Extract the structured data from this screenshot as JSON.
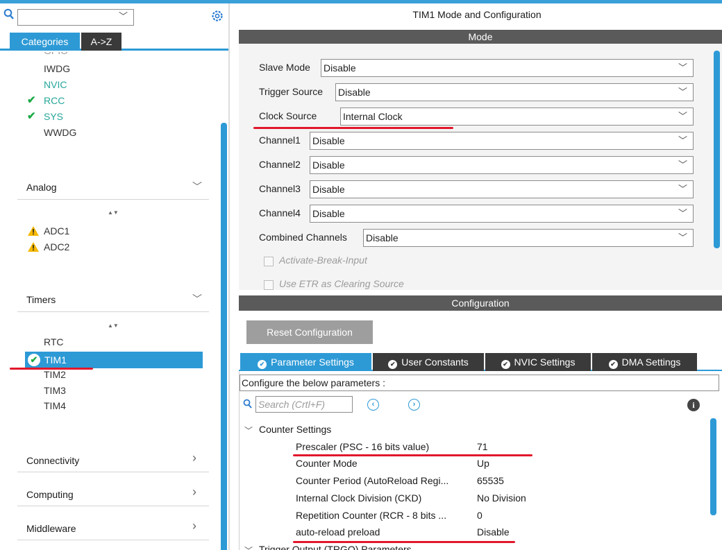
{
  "left": {
    "search": {
      "value": "",
      "chevron": "﹀"
    },
    "tabs": {
      "categories": "Categories",
      "az": "A->Z"
    },
    "system_core_items": [
      {
        "label": "GPIO",
        "status": "none"
      },
      {
        "label": "IWDG",
        "status": "none"
      },
      {
        "label": "NVIC",
        "status": "none"
      },
      {
        "label": "RCC",
        "status": "ok"
      },
      {
        "label": "SYS",
        "status": "ok"
      },
      {
        "label": "WWDG",
        "status": "none"
      }
    ],
    "categories": {
      "analog": "Analog",
      "timers": "Timers",
      "connectivity": "Connectivity",
      "computing": "Computing",
      "middleware": "Middleware"
    },
    "analog_items": [
      {
        "label": "ADC1",
        "status": "warning"
      },
      {
        "label": "ADC2",
        "status": "warning"
      }
    ],
    "timers_items": [
      {
        "label": "RTC",
        "status": "none"
      },
      {
        "label": "TIM1",
        "status": "selected-ok"
      },
      {
        "label": "TIM2",
        "status": "none"
      },
      {
        "label": "TIM3",
        "status": "none"
      },
      {
        "label": "TIM4",
        "status": "none"
      }
    ],
    "chevron_down": "﹀",
    "chevron_right": "›",
    "sort_glyph": "▲▼"
  },
  "right": {
    "title": "TIM1 Mode and Configuration",
    "mode_header": "Mode",
    "mode_fields": [
      {
        "label": "Slave Mode",
        "value": "Disable"
      },
      {
        "label": "Trigger Source",
        "value": "Disable"
      },
      {
        "label": "Clock Source",
        "value": "Internal Clock"
      },
      {
        "label": "Channel1",
        "value": "Disable"
      },
      {
        "label": "Channel2",
        "value": "Disable"
      },
      {
        "label": "Channel3",
        "value": "Disable"
      },
      {
        "label": "Channel4",
        "value": "Disable"
      },
      {
        "label": "Combined Channels",
        "value": "Disable"
      }
    ],
    "mode_checkboxes": [
      {
        "label": "Activate-Break-Input",
        "checked": false
      },
      {
        "label": "Use ETR as Clearing Source",
        "checked": false
      }
    ],
    "config_header": "Configuration",
    "reset_button": "Reset Configuration",
    "param_tabs": [
      {
        "label": "Parameter Settings",
        "active": true
      },
      {
        "label": "User Constants",
        "active": false
      },
      {
        "label": "NVIC Settings",
        "active": false
      },
      {
        "label": "DMA Settings",
        "active": false
      }
    ],
    "config_hint": "Configure the below parameters :",
    "param_search_placeholder": "Search (Crtl+F)",
    "nav_prev": "‹",
    "nav_next": "›",
    "info_glyph": "i",
    "group_counter": "Counter Settings",
    "group_trigger": "Trigger Output (TRGO) Parameters",
    "parameters": [
      {
        "name": "Prescaler (PSC - 16 bits value)",
        "value": "71"
      },
      {
        "name": "Counter Mode",
        "value": "Up"
      },
      {
        "name": "Counter Period (AutoReload Regi...",
        "value": "65535"
      },
      {
        "name": "Internal Clock Division (CKD)",
        "value": "No Division"
      },
      {
        "name": "Repetition Counter (RCR - 8 bits ...",
        "value": "0"
      },
      {
        "name": "auto-reload preload",
        "value": "Disable"
      }
    ]
  },
  "colors": {
    "accent": "#2d9ad6",
    "header_dark": "#5a5a5a",
    "ok_green": "#1bab45",
    "annotation_red": "#e2172b"
  }
}
